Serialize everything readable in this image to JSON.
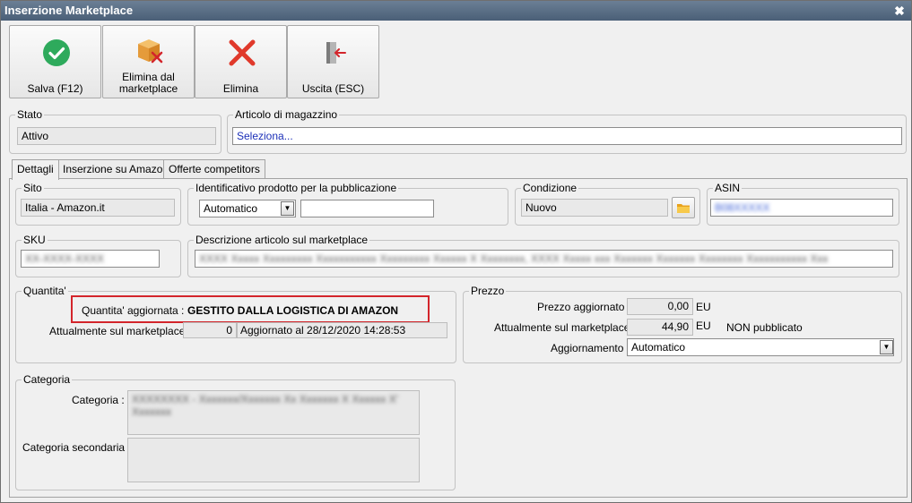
{
  "window": {
    "title": "Inserzione Marketplace"
  },
  "icons": {
    "close": "close-icon",
    "save": "check-circle-icon",
    "delete_marketplace": "box-remove-icon",
    "delete": "x-icon",
    "exit": "exit-door-icon",
    "folder": "folder-icon"
  },
  "toolbar": {
    "save_label": "Salva (F12)",
    "delete_marketplace_label": "Elimina dal marketplace",
    "delete_label": "Elimina",
    "exit_label": "Uscita (ESC)"
  },
  "stato": {
    "legend": "Stato",
    "value": "Attivo"
  },
  "articolo": {
    "legend": "Articolo di magazzino",
    "value": "Seleziona..."
  },
  "tabs": [
    {
      "label": "Dettagli",
      "active": true
    },
    {
      "label": "Inserzione su Amazon",
      "active": false
    },
    {
      "label": "Offerte competitors",
      "active": false
    }
  ],
  "sito": {
    "legend": "Sito",
    "value": "Italia - Amazon.it"
  },
  "identificativo": {
    "legend": "Identificativo prodotto per la pubblicazione",
    "selected": "Automatico",
    "value": ""
  },
  "condizione": {
    "legend": "Condizione",
    "value": "Nuovo"
  },
  "asin": {
    "legend": "ASIN",
    "value": "B08XXXXX"
  },
  "sku": {
    "legend": "SKU",
    "value": "XX-XXXX-XXXX"
  },
  "descrizione": {
    "legend": "Descrizione articolo sul marketplace",
    "value": "XXXX Xxxxx Xxxxxxxxx Xxxxxxxxxxx Xxxxxxxxx Xxxxxx X Xxxxxxxx, XXXX Xxxxx xxx Xxxxxxx Xxxxxxx Xxxxxxxx Xxxxxxxxxxx Xxx"
  },
  "quantita": {
    "legend": "Quantita'",
    "aggiornata_label": "Quantita' aggiornata :",
    "aggiornata_value": "GESTITO DALLA LOGISTICA DI AMAZON",
    "marketplace_label": "Attualmente sul marketplace :",
    "marketplace_value": "0",
    "aggiornato": "Aggiornato al 28/12/2020 14:28:53"
  },
  "prezzo": {
    "legend": "Prezzo",
    "aggiornato_label": "Prezzo aggiornato :",
    "aggiornato_value": "0,00",
    "currency": "EU",
    "marketplace_label": "Attualmente sul marketplace :",
    "marketplace_value": "44,90",
    "non_pubblicato": "NON pubblicato",
    "aggiornamento_label": "Aggiornamento :",
    "aggiornamento_value": "Automatico"
  },
  "categoria": {
    "legend": "Categoria",
    "categoria_label": "Categoria :",
    "categoria_value": "XXXXXXXX - Xxxxxxx/Xxxxxxx Xx Xxxxxxx X Xxxxxx X' Xxxxxxx",
    "secondaria_label": "Categoria secondaria :",
    "secondaria_value": ""
  }
}
